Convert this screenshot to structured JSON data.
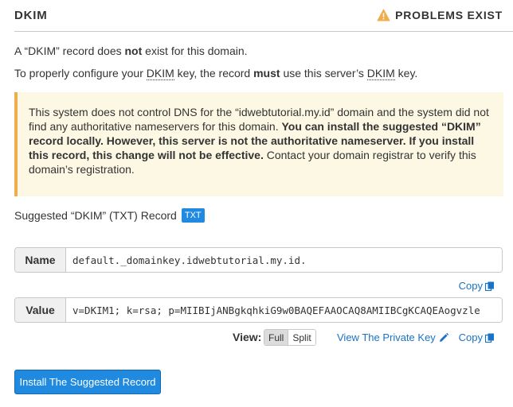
{
  "header": {
    "title": "DKIM",
    "status": "PROBLEMS EXIST",
    "status_icon": "warning-icon",
    "status_color": "#f0ad4e"
  },
  "intro": {
    "line1_pre": "A “DKIM” record does ",
    "line1_bold": "not",
    "line1_post": " exist for this domain.",
    "line2_pre": "To properly configure your ",
    "line2_abbr": "DKIM",
    "line2_mid": " key, the record ",
    "line2_bold": "must",
    "line2_mid2": " use this server’s ",
    "line2_abbr2": "DKIM",
    "line2_post": " key."
  },
  "alert": {
    "text_pre": "This system does not control DNS for the “idwebtutorial.my.id” domain and the system did not find any authoritative nameservers for this domain. ",
    "text_bold": "You can install the suggested “DKIM” record locally. However, this server is not the authoritative nameserver. If you install this record, this change will not be effective.",
    "text_post": " Contact your domain registrar to verify this domain’s registration."
  },
  "suggested": {
    "title": "Suggested “DKIM” (TXT) Record",
    "badge": "TXT"
  },
  "name_field": {
    "label": "Name",
    "value": "default._domainkey.idwebtutorial.my.id."
  },
  "value_field": {
    "label": "Value",
    "value": "v=DKIM1; k=rsa; p=MIIBIjANBgkqhkiG9w0BAQEFAAOCAQ8AMIIBCgKCAQEAogvzle"
  },
  "copy_label": "Copy",
  "view": {
    "label": "View:",
    "full": "Full",
    "split": "Split"
  },
  "private_key_link": "View The Private Key",
  "install_button": "Install The Suggested Record",
  "colors": {
    "accent": "#1f8ae0",
    "link": "#1a73c4",
    "alert_bg": "#fcf8e3",
    "alert_border": "#f0ad4e"
  }
}
